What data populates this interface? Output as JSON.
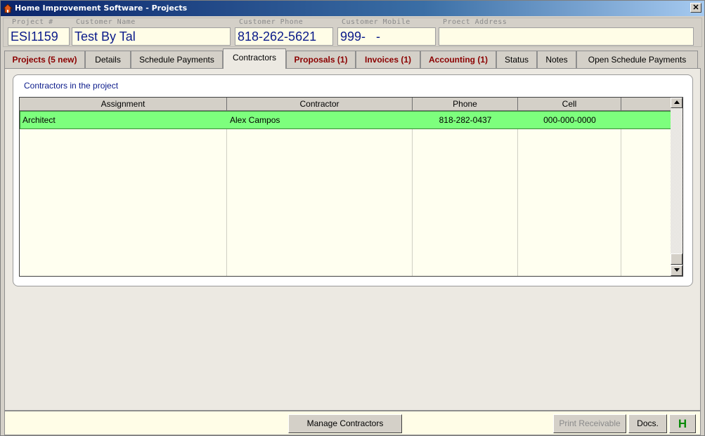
{
  "window": {
    "title": "Home Improvement Software - Projects",
    "close_glyph": "✕"
  },
  "header": {
    "project_no": {
      "label": "Project #",
      "value": "ESI1159"
    },
    "customer_name": {
      "label": "Customer Name",
      "value": "Test By Tal"
    },
    "customer_phone": {
      "label": "Customer Phone",
      "value": "818-262-5621"
    },
    "customer_mobile": {
      "label": "Customer Mobile",
      "value": "999-   -"
    },
    "project_address": {
      "label": "Proect Address",
      "value": ""
    }
  },
  "tabs": [
    {
      "label": "Projects (5 new)",
      "highlight": true
    },
    {
      "label": "Details"
    },
    {
      "label": "Schedule Payments"
    },
    {
      "label": "Contractors",
      "active": true
    },
    {
      "label": "Proposals (1)",
      "highlight": true
    },
    {
      "label": "Invoices (1)",
      "highlight": true
    },
    {
      "label": "Accounting (1)",
      "highlight": true
    },
    {
      "label": "Status"
    },
    {
      "label": "Notes"
    },
    {
      "label": "Open Schedule Payments"
    }
  ],
  "contractors": {
    "group_title": "Contractors in the project",
    "columns": [
      "Assignment",
      "Contractor",
      "Phone",
      "Cell",
      ""
    ],
    "rows": [
      {
        "assignment": "Architect",
        "contractor": "Alex Campos",
        "phone": "818-282-0437",
        "cell": "000-000-0000"
      }
    ],
    "selected_row_color": "#7dff7d"
  },
  "footer": {
    "manage_contractors": "Manage Contractors",
    "print_receivable": "Print Receivable",
    "docs": "Docs.",
    "h": "H"
  },
  "colors": {
    "title_gradient_start": "#0a246a",
    "field_bg": "#fffde7",
    "field_text": "#0a1a8a",
    "tab_highlight": "#8b0000"
  }
}
